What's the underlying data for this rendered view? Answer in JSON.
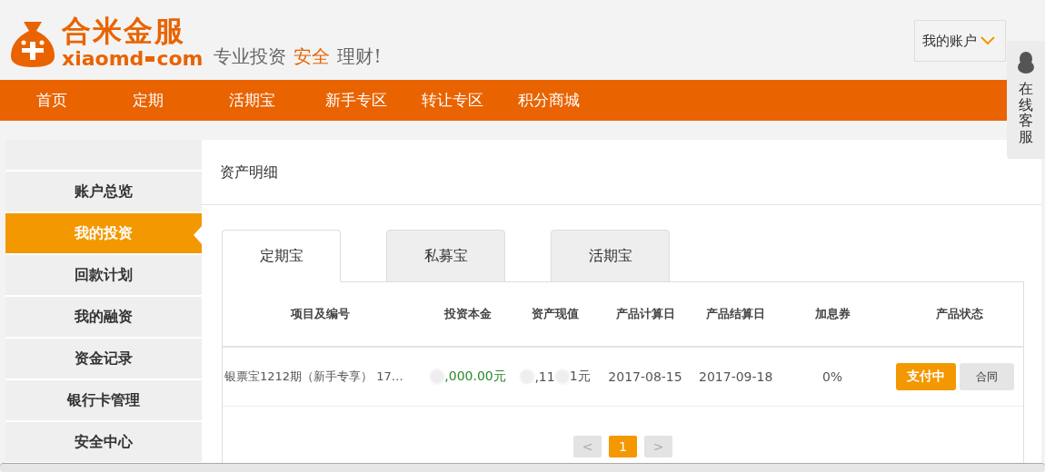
{
  "logo": {
    "name": "合米金服",
    "domain_left": "xiaomd",
    "domain_right": "com"
  },
  "slogan": [
    {
      "text": "专业投资",
      "highlight": false
    },
    {
      "text": "安全",
      "highlight": true
    },
    {
      "text": "理财!",
      "highlight": false
    }
  ],
  "account_button": {
    "label": "我的账户"
  },
  "nav": [
    {
      "label": "首页"
    },
    {
      "label": "定期"
    },
    {
      "label": "活期宝"
    },
    {
      "label": "新手专区"
    },
    {
      "label": "转让专区"
    },
    {
      "label": "积分商城"
    }
  ],
  "service_panel": {
    "label": "在线客服"
  },
  "sidebar": [
    {
      "label": "账户总览",
      "selected": false
    },
    {
      "label": "我的投资",
      "selected": true
    },
    {
      "label": "回款计划",
      "selected": false
    },
    {
      "label": "我的融资",
      "selected": false
    },
    {
      "label": "资金记录",
      "selected": false
    },
    {
      "label": "银行卡管理",
      "selected": false
    },
    {
      "label": "安全中心",
      "selected": false
    }
  ],
  "panel_title": "资产明细",
  "tabs": [
    {
      "label": "定期宝",
      "selected": true
    },
    {
      "label": "私募宝",
      "selected": false
    },
    {
      "label": "活期宝",
      "selected": false
    }
  ],
  "table": {
    "columns": [
      "项目及编号",
      "投资本金",
      "资产现值",
      "产品计算日",
      "产品结算日",
      "加息券",
      "产品状态"
    ],
    "rows": [
      {
        "project": "银票宝1212期（新手专享） 17…",
        "principal": ",000.00元",
        "value_parts": [
          ",11",
          "1元"
        ],
        "start": "2017-08-15",
        "end": "2017-09-18",
        "coupon": "0%",
        "status": "支付中",
        "contract": "合同"
      }
    ]
  },
  "pagination": {
    "prev": "<",
    "next": ">",
    "pages": [
      {
        "label": "1",
        "selected": true
      }
    ]
  }
}
